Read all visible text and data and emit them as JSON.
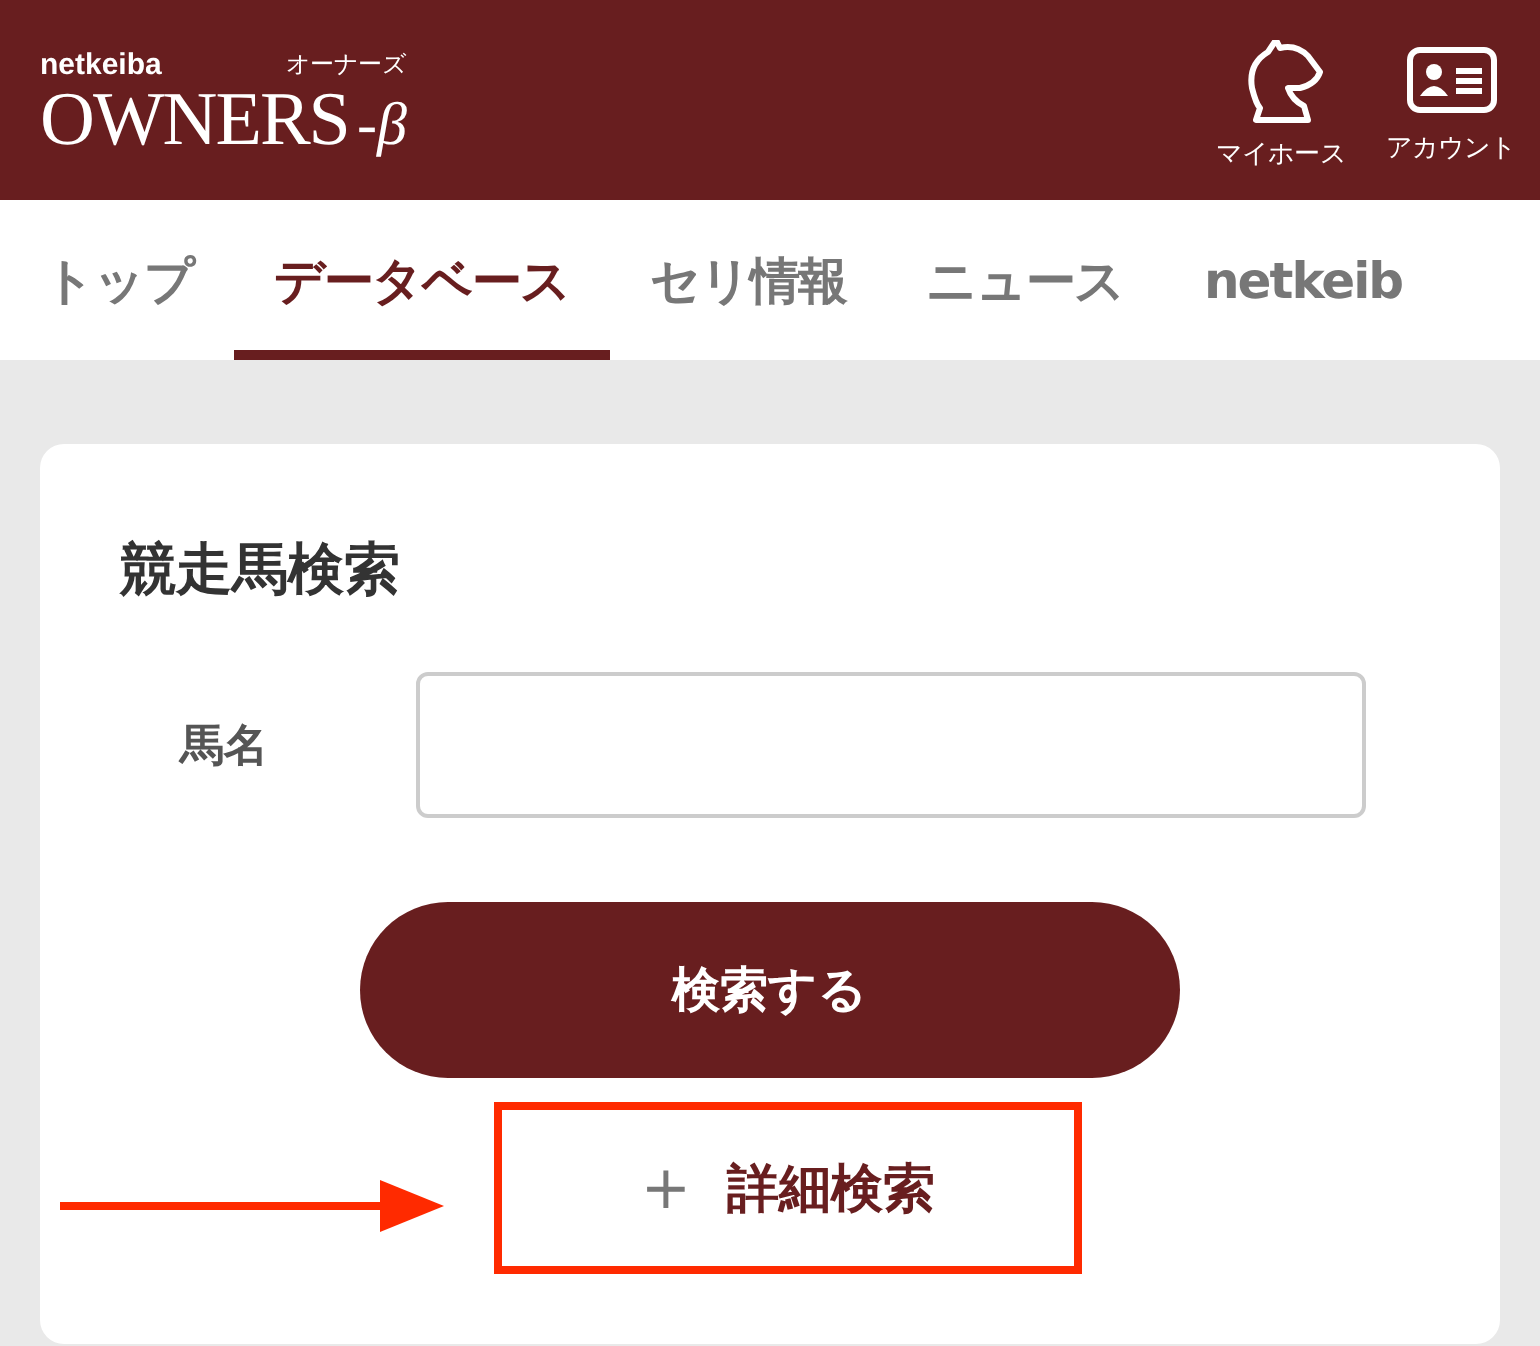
{
  "header": {
    "brand_small": "netkeiba",
    "brand_sub": "オーナーズ",
    "brand_main": "OWNERS",
    "brand_suffix": "-β",
    "actions": [
      {
        "kind": "horse",
        "label": "マイホース"
      },
      {
        "kind": "account",
        "label": "アカウント"
      }
    ]
  },
  "tabs": [
    {
      "label": "トップ",
      "selected": false
    },
    {
      "label": "データベース",
      "selected": true
    },
    {
      "label": "セリ情報",
      "selected": false
    },
    {
      "label": "ニュース",
      "selected": false
    },
    {
      "label": "netkeib",
      "selected": false
    }
  ],
  "search_card": {
    "title": "競走馬検索",
    "field_label": "馬名",
    "search_button": "検索する",
    "detail_link": {
      "icon": "+",
      "label": "詳細検索",
      "highlighted": true
    }
  }
}
